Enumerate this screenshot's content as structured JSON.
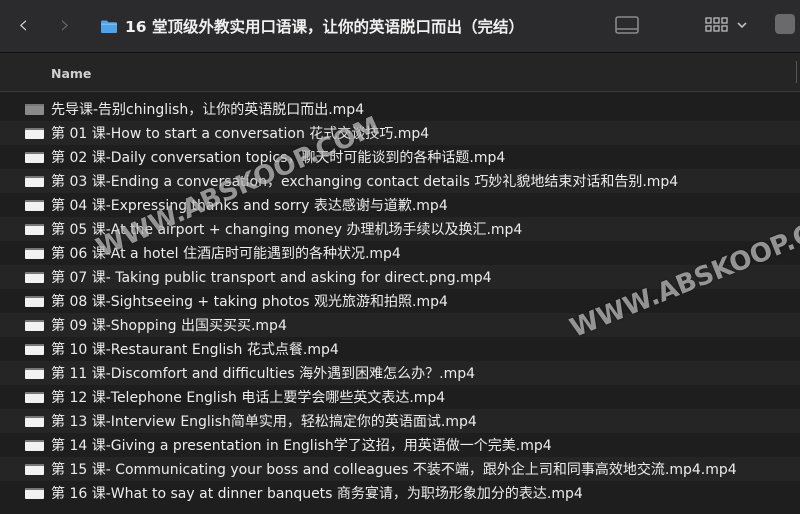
{
  "toolbar": {
    "back_icon": "chevron-left-icon",
    "forward_icon": "chevron-right-icon",
    "folder_icon": "folder-icon",
    "title": "16 堂顶级外教实用口语课，让你的英语脱口而出（完结）",
    "sidebar_icon": "sidebar-icon",
    "view_icon": "grid-view-icon",
    "chevron_icon": "chevron-down-icon"
  },
  "header": {
    "name_label": "Name"
  },
  "files": [
    {
      "name": "先导课-告别chinglish，让你的英语脱口而出.mp4"
    },
    {
      "name": "第 01 课-How to start a conversation 花式交谈技巧.mp4"
    },
    {
      "name": "第 02 课-Daily conversation topics，聊天时可能谈到的各种话题.mp4"
    },
    {
      "name": "第 03 课-Ending a conversation，exchanging contact details 巧妙礼貌地结束对话和告别.mp4"
    },
    {
      "name": "第 04 课-Expressing thanks and sorry 表达感谢与道歉.mp4"
    },
    {
      "name": "第 05 课-At the airport + changing money 办理机场手续以及换汇.mp4"
    },
    {
      "name": "第 06 课-At a hotel 住酒店时可能遇到的各种状况.mp4"
    },
    {
      "name": "第 07 课- Taking public transport and asking for direct.png.mp4"
    },
    {
      "name": "第 08 课-Sightseeing + taking photos 观光旅游和拍照.mp4"
    },
    {
      "name": "第 09 课-Shopping 出国买买买.mp4"
    },
    {
      "name": "第 10 课-Restaurant English 花式点餐.mp4"
    },
    {
      "name": "第 11 课-Discomfort and difficulties 海外遇到困难怎么办？.mp4"
    },
    {
      "name": "第 12 课-Telephone English 电话上要学会哪些英文表达.mp4"
    },
    {
      "name": "第 13 课-Interview English简单实用，轻松搞定你的英语面试.mp4"
    },
    {
      "name": "第 14 课-Giving a presentation in English学了这招，用英语做一个完美.mp4"
    },
    {
      "name": "第 15 课- Communicating your boss and colleagues 不装不端，跟外企上司和同事高效地交流.mp4.mp4"
    },
    {
      "name": "第 16 课-What to say at dinner banquets 商务宴请，为职场形象加分的表达.mp4"
    }
  ],
  "watermarks": {
    "mark1": "WWW.ABSKOOP.COM",
    "mark2": "WWW.ABSKOOP.COM"
  },
  "colors": {
    "background": "#1e1e1f",
    "toolbar": "#2b2a2c",
    "folder": "#4fa3e8",
    "text": "#ececec"
  }
}
